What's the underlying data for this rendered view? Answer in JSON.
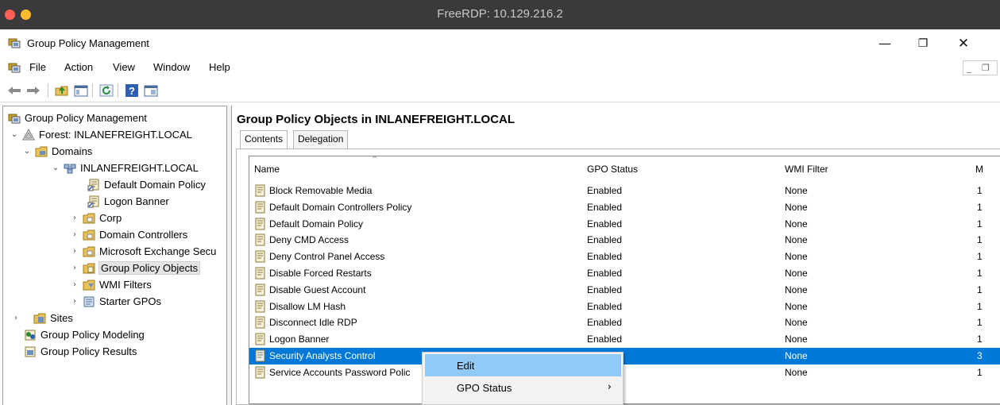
{
  "rdp": {
    "title": "FreeRDP: 10.129.216.2"
  },
  "window": {
    "title": "Group Policy Management",
    "minimize": "—",
    "maximize": "❐",
    "close": "✕"
  },
  "menu": {
    "items": [
      "File",
      "Action",
      "View",
      "Window",
      "Help"
    ]
  },
  "mdi_controls": "_ ❐ ×",
  "toolbar": {
    "buttons": [
      "back-arrow-icon",
      "forward-arrow-icon",
      "up-folder-icon",
      "show-hide-tree-icon",
      "refresh-icon",
      "help-icon",
      "mmc-properties-icon"
    ]
  },
  "tree": {
    "root": "Group Policy Management",
    "forest": "Forest: INLANEFREIGHT.LOCAL",
    "domains": "Domains",
    "domain": "INLANEFREIGHT.LOCAL",
    "items": [
      "Default Domain Policy",
      "Logon Banner",
      "Corp",
      "Domain Controllers",
      "Microsoft Exchange Secu",
      "Group Policy Objects",
      "WMI Filters",
      "Starter GPOs"
    ],
    "sites": "Sites",
    "modeling": "Group Policy Modeling",
    "results": "Group Policy Results"
  },
  "main": {
    "title": "Group Policy Objects in INLANEFREIGHT.LOCAL",
    "tabs": [
      "Contents",
      "Delegation"
    ],
    "columns": [
      "Name",
      "GPO Status",
      "WMI Filter",
      "M"
    ],
    "rows": [
      {
        "name": "Block Removable Media",
        "status": "Enabled",
        "wmi": "None",
        "m": "1"
      },
      {
        "name": "Default Domain Controllers Policy",
        "status": "Enabled",
        "wmi": "None",
        "m": "1"
      },
      {
        "name": "Default Domain Policy",
        "status": "Enabled",
        "wmi": "None",
        "m": "1"
      },
      {
        "name": "Deny CMD Access",
        "status": "Enabled",
        "wmi": "None",
        "m": "1"
      },
      {
        "name": "Deny Control Panel Access",
        "status": "Enabled",
        "wmi": "None",
        "m": "1"
      },
      {
        "name": "Disable Forced Restarts",
        "status": "Enabled",
        "wmi": "None",
        "m": "1"
      },
      {
        "name": "Disable Guest Account",
        "status": "Enabled",
        "wmi": "None",
        "m": "1"
      },
      {
        "name": "Disallow LM Hash",
        "status": "Enabled",
        "wmi": "None",
        "m": "1"
      },
      {
        "name": "Disconnect Idle RDP",
        "status": "Enabled",
        "wmi": "None",
        "m": "1"
      },
      {
        "name": "Logon Banner",
        "status": "Enabled",
        "wmi": "None",
        "m": "1"
      },
      {
        "name": "Security Analysts Control",
        "status": "",
        "wmi": "None",
        "m": "3"
      },
      {
        "name": "Service Accounts Password Polic",
        "status": "",
        "wmi": "None",
        "m": "1"
      }
    ]
  },
  "context_menu": {
    "items": [
      {
        "label": "Edit",
        "arrow": ""
      },
      {
        "label": "GPO Status",
        "arrow": "›"
      }
    ]
  },
  "colors": {
    "selection": "#0078d7",
    "menu_hover": "#91c9f7",
    "rdp_bar": "#3a3a3c"
  }
}
